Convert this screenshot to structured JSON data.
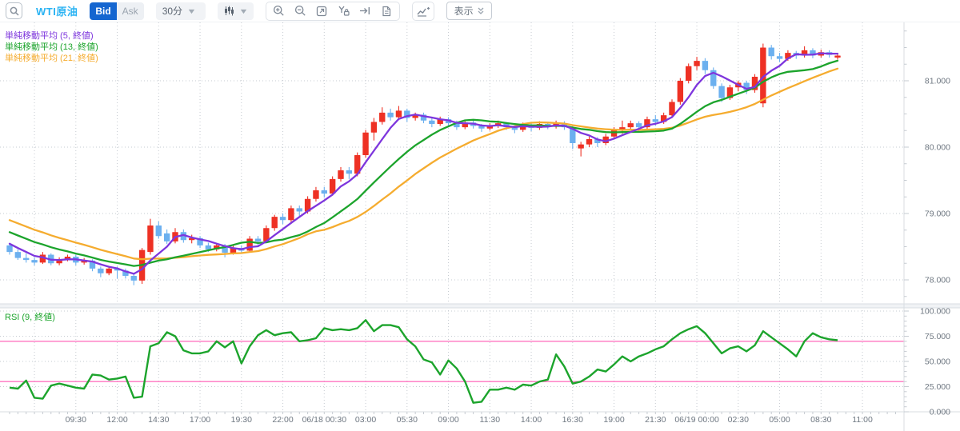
{
  "toolbar": {
    "symbol": "WTI原油",
    "bid_label": "Bid",
    "ask_label": "Ask",
    "timeframe": "30分",
    "display_label": "表示",
    "icons": [
      "search-icon",
      "candlestick-type-icon",
      "zoom-in-icon",
      "zoom-out-icon",
      "fit-screen-icon",
      "y-axis-lock-icon",
      "go-to-end-icon",
      "document-icon",
      "add-indicator-icon",
      "double-chevron-icon"
    ]
  },
  "legend": {
    "items": [
      {
        "label": "単純移動平均 (5, 終値)",
        "color": "#7e36dd"
      },
      {
        "label": "単純移動平均 (13, 終値)",
        "color": "#1ca42c"
      },
      {
        "label": "単純移動平均 (21, 終値)",
        "color": "#f5ac2f"
      }
    ],
    "rsi_label": "RSI (9, 終値)"
  },
  "colors": {
    "up_candle": "#ee3124",
    "down_candle": "#6cb0ef",
    "ma5": "#7e36dd",
    "ma13": "#1ca42c",
    "ma21": "#f5ac2f",
    "rsi_line": "#1ca42c",
    "rsi_band": "#ff74c0",
    "grid": "#c6cbd1",
    "axis_text": "#6e7781",
    "axis_line": "#d9dde2"
  },
  "chart_data": {
    "type": "candlestick",
    "symbol": "WTI原油",
    "interval": "30分",
    "price_axis": {
      "tick_labels": [
        "81.000",
        "80.000",
        "79.000",
        "78.000"
      ],
      "tick_values": [
        81,
        80,
        79,
        78
      ],
      "min": 77.7,
      "max": 81.88
    },
    "rsi_axis": {
      "tick_labels": [
        "100.000",
        "75.000",
        "50.000",
        "25.000",
        "0.000"
      ],
      "tick_values": [
        100,
        75,
        50,
        25,
        0
      ],
      "overbought": 70,
      "oversold": 30
    },
    "time_labels": [
      "09:30",
      "12:00",
      "14:30",
      "17:00",
      "19:30",
      "22:00",
      "06/18 00:30",
      "03:00",
      "05:30",
      "09:00",
      "11:30",
      "14:00",
      "16:30",
      "19:00",
      "21:30",
      "06/19 00:00",
      "02:30",
      "05:00",
      "08:30",
      "11:00"
    ],
    "time_label_first_candle_index": 8,
    "time_label_candle_step": 5,
    "candles": [
      [
        78.52,
        78.55,
        78.38,
        78.42
      ],
      [
        78.42,
        78.46,
        78.3,
        78.33
      ],
      [
        78.33,
        78.4,
        78.26,
        78.3
      ],
      [
        78.3,
        78.34,
        78.22,
        78.26
      ],
      [
        78.26,
        78.42,
        78.24,
        78.38
      ],
      [
        78.38,
        78.4,
        78.22,
        78.25
      ],
      [
        78.25,
        78.34,
        78.22,
        78.31
      ],
      [
        78.31,
        78.38,
        78.28,
        78.35
      ],
      [
        78.35,
        78.38,
        78.22,
        78.26
      ],
      [
        78.26,
        78.33,
        78.23,
        78.29
      ],
      [
        78.29,
        78.31,
        78.13,
        78.17
      ],
      [
        78.17,
        78.2,
        78.04,
        78.1
      ],
      [
        78.1,
        78.2,
        78.07,
        78.17
      ],
      [
        78.17,
        78.2,
        78.02,
        78.14
      ],
      [
        78.14,
        78.17,
        78.02,
        78.06
      ],
      [
        78.06,
        78.1,
        77.92,
        77.99
      ],
      [
        77.99,
        78.48,
        77.94,
        78.45
      ],
      [
        78.42,
        78.92,
        78.38,
        78.82
      ],
      [
        78.82,
        78.88,
        78.62,
        78.66
      ],
      [
        78.7,
        78.76,
        78.54,
        78.58
      ],
      [
        78.58,
        78.78,
        78.55,
        78.72
      ],
      [
        78.72,
        78.76,
        78.56,
        78.6
      ],
      [
        78.6,
        78.68,
        78.55,
        78.63
      ],
      [
        78.63,
        78.66,
        78.48,
        78.52
      ],
      [
        78.52,
        78.56,
        78.42,
        78.46
      ],
      [
        78.46,
        78.55,
        78.43,
        78.52
      ],
      [
        78.52,
        78.54,
        78.34,
        78.41
      ],
      [
        78.41,
        78.52,
        78.38,
        78.48
      ],
      [
        78.48,
        78.52,
        78.4,
        78.44
      ],
      [
        78.44,
        78.66,
        78.42,
        78.62
      ],
      [
        78.62,
        78.66,
        78.52,
        78.58
      ],
      [
        78.58,
        78.82,
        78.56,
        78.78
      ],
      [
        78.78,
        78.98,
        78.74,
        78.95
      ],
      [
        78.95,
        79.0,
        78.84,
        78.9
      ],
      [
        78.9,
        79.12,
        78.87,
        79.08
      ],
      [
        79.08,
        79.12,
        78.96,
        79.03
      ],
      [
        79.03,
        79.26,
        79.0,
        79.22
      ],
      [
        79.22,
        79.4,
        79.18,
        79.35
      ],
      [
        79.35,
        79.4,
        79.24,
        79.3
      ],
      [
        79.3,
        79.56,
        79.27,
        79.52
      ],
      [
        79.52,
        79.7,
        79.48,
        79.65
      ],
      [
        79.65,
        79.7,
        79.52,
        79.6
      ],
      [
        79.6,
        79.92,
        79.56,
        79.88
      ],
      [
        79.88,
        80.26,
        79.84,
        80.22
      ],
      [
        80.22,
        80.44,
        80.1,
        80.38
      ],
      [
        80.38,
        80.6,
        80.34,
        80.52
      ],
      [
        80.52,
        80.58,
        80.4,
        80.45
      ],
      [
        80.45,
        80.62,
        80.42,
        80.55
      ],
      [
        80.55,
        80.58,
        80.38,
        80.44
      ],
      [
        80.44,
        80.52,
        80.4,
        80.49
      ],
      [
        80.49,
        80.52,
        80.36,
        80.4
      ],
      [
        80.4,
        80.44,
        80.3,
        80.35
      ],
      [
        80.35,
        80.46,
        80.32,
        80.42
      ],
      [
        80.42,
        80.45,
        80.32,
        80.36
      ],
      [
        80.36,
        80.4,
        80.26,
        80.3
      ],
      [
        80.3,
        80.4,
        80.27,
        80.37
      ],
      [
        80.37,
        80.4,
        80.28,
        80.32
      ],
      [
        80.32,
        80.35,
        80.23,
        80.28
      ],
      [
        80.28,
        80.36,
        80.25,
        80.32
      ],
      [
        80.32,
        80.4,
        80.29,
        80.36
      ],
      [
        80.36,
        80.38,
        80.26,
        80.3
      ],
      [
        80.3,
        80.33,
        80.21,
        80.26
      ],
      [
        80.26,
        80.37,
        80.23,
        80.33
      ],
      [
        80.33,
        80.36,
        80.24,
        80.29
      ],
      [
        80.29,
        80.39,
        80.26,
        80.35
      ],
      [
        80.35,
        80.38,
        80.27,
        80.31
      ],
      [
        80.31,
        80.4,
        80.28,
        80.36
      ],
      [
        80.36,
        80.39,
        80.26,
        80.3
      ],
      [
        80.3,
        80.32,
        79.97,
        80.06
      ],
      [
        79.98,
        80.08,
        79.86,
        80.04
      ],
      [
        80.04,
        80.16,
        80.0,
        80.12
      ],
      [
        80.12,
        80.15,
        80.0,
        80.06
      ],
      [
        80.06,
        80.2,
        80.03,
        80.16
      ],
      [
        80.16,
        80.3,
        80.13,
        80.26
      ],
      [
        80.26,
        80.4,
        80.2,
        80.3
      ],
      [
        80.3,
        80.4,
        80.26,
        80.36
      ],
      [
        80.36,
        80.39,
        80.24,
        80.3
      ],
      [
        80.3,
        80.46,
        80.27,
        80.42
      ],
      [
        80.42,
        80.48,
        80.32,
        80.38
      ],
      [
        80.38,
        80.52,
        80.35,
        80.48
      ],
      [
        80.48,
        80.72,
        80.45,
        80.68
      ],
      [
        80.68,
        81.04,
        80.64,
        81.0
      ],
      [
        81.0,
        81.26,
        80.96,
        81.22
      ],
      [
        81.22,
        81.36,
        81.16,
        81.3
      ],
      [
        81.3,
        81.34,
        81.1,
        81.16
      ],
      [
        81.16,
        81.2,
        80.88,
        80.92
      ],
      [
        80.92,
        80.96,
        80.68,
        80.74
      ],
      [
        80.74,
        80.94,
        80.71,
        80.9
      ],
      [
        80.9,
        81.0,
        80.84,
        80.97
      ],
      [
        80.97,
        81.0,
        80.8,
        80.86
      ],
      [
        80.86,
        81.1,
        80.82,
        81.06
      ],
      [
        80.66,
        81.56,
        80.6,
        81.5
      ],
      [
        81.5,
        81.54,
        81.32,
        81.37
      ],
      [
        81.37,
        81.42,
        81.28,
        81.33
      ],
      [
        81.33,
        81.46,
        81.3,
        81.42
      ],
      [
        81.42,
        81.45,
        81.33,
        81.38
      ],
      [
        81.38,
        81.52,
        81.35,
        81.46
      ],
      [
        81.46,
        81.49,
        81.34,
        81.38
      ],
      [
        81.38,
        81.47,
        81.35,
        81.43
      ],
      [
        81.43,
        81.46,
        81.35,
        81.39
      ],
      [
        81.35,
        81.42,
        81.32,
        81.38
      ]
    ],
    "moving_averages": {
      "type": "SMA",
      "source": "close",
      "periods": [
        5,
        13,
        21
      ],
      "colors": [
        "#7e36dd",
        "#1ca42c",
        "#f5ac2f"
      ],
      "seed_closes_before_view": [
        79.4,
        79.35,
        79.3,
        79.28,
        79.22,
        79.18,
        79.12,
        79.08,
        79.02,
        78.98,
        78.95,
        78.9,
        78.85,
        78.8,
        78.75,
        78.72,
        78.68,
        78.65,
        78.6,
        78.55,
        78.5
      ]
    },
    "rsi": {
      "period": 9,
      "source": "close",
      "color": "#1ca42c",
      "values": [
        24,
        23,
        31,
        14,
        13,
        26,
        28,
        26,
        24,
        23,
        37,
        36,
        32,
        33,
        35,
        14,
        15,
        65,
        68,
        79,
        75,
        61,
        58,
        58,
        60,
        70,
        64,
        70,
        48,
        65,
        76,
        81,
        76,
        78,
        79,
        70,
        71,
        73,
        83,
        81,
        82,
        81,
        83,
        91,
        80,
        86,
        86,
        84,
        72,
        65,
        52,
        49,
        37,
        51,
        43,
        30,
        9,
        10,
        22,
        22,
        24,
        22,
        27,
        26,
        30,
        32,
        57,
        45,
        28,
        30,
        35,
        42,
        40,
        47,
        55,
        50,
        55,
        58,
        62,
        65,
        72,
        78,
        82,
        85,
        78,
        68,
        58,
        63,
        65,
        60,
        66,
        80,
        74,
        68,
        62,
        55,
        70,
        78,
        74,
        72,
        71
      ]
    }
  }
}
